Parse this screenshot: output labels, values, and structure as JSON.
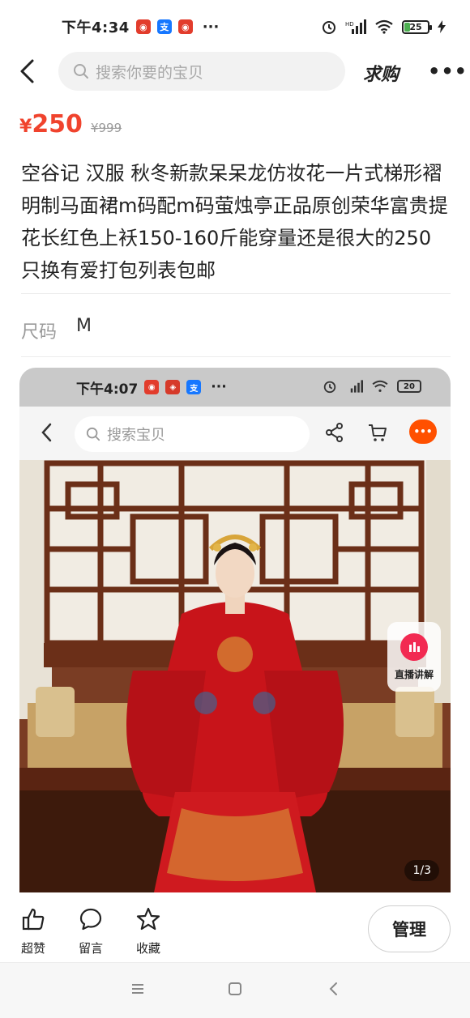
{
  "status_bar": {
    "time": "下午4:34",
    "more": "···",
    "battery": "25"
  },
  "nav": {
    "search_placeholder": "搜索你要的宝贝",
    "qiugou_label": "求购"
  },
  "product": {
    "price_symbol": "¥",
    "price": "250",
    "original_price": "¥999",
    "title": "空谷记 汉服 秋冬新款呆呆龙仿妆花一片式梯形褶明制马面裙m码配m码萤烛亭正品原创荣华富贵提花长红色上袄150-160斤能穿量还是很大的250只换有爱打包列表包邮",
    "size_label": "尺码",
    "size_value": "M"
  },
  "embedded_screenshot": {
    "time": "下午4:07",
    "more": "···",
    "battery": "20",
    "search_placeholder": "搜索宝贝",
    "live_label": "直播讲解",
    "pager": "1/3"
  },
  "actions": {
    "like_label": "超赞",
    "comment_label": "留言",
    "favorite_label": "收藏",
    "manage_label": "管理"
  },
  "colors": {
    "price": "#f0432d",
    "taobao_orange": "#ff5000",
    "live_red": "#f22a52"
  }
}
